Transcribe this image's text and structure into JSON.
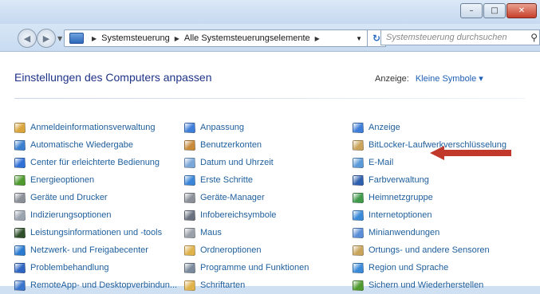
{
  "window": {
    "minimize": "–",
    "maximize": "□",
    "close": "✕"
  },
  "address": {
    "crumb1": "Systemsteuerung",
    "crumb2": "Alle Systemsteuerungselemente",
    "search_placeholder": "Systemsteuerung durchsuchen"
  },
  "header": {
    "title": "Einstellungen des Computers anpassen",
    "view_label": "Anzeige:",
    "view_value": "Kleine Symbole ▾"
  },
  "columns": [
    [
      {
        "label": "Anmeldeinformationsverwaltung",
        "icon": "credential-icon",
        "color": "#d9a53b"
      },
      {
        "label": "Automatische Wiedergabe",
        "icon": "autoplay-icon",
        "color": "#3a7fd0"
      },
      {
        "label": "Center für erleichterte Bedienung",
        "icon": "ease-of-access-icon",
        "color": "#2f6fd6"
      },
      {
        "label": "Energieoptionen",
        "icon": "power-icon",
        "color": "#4e9a2e"
      },
      {
        "label": "Geräte und Drucker",
        "icon": "printer-icon",
        "color": "#8a8f98"
      },
      {
        "label": "Indizierungsoptionen",
        "icon": "indexing-icon",
        "color": "#9aa3b0"
      },
      {
        "label": "Leistungsinformationen und -tools",
        "icon": "performance-icon",
        "color": "#2e4f2a"
      },
      {
        "label": "Netzwerk- und Freigabecenter",
        "icon": "network-icon",
        "color": "#2a7ad0"
      },
      {
        "label": "Problembehandlung",
        "icon": "troubleshoot-icon",
        "color": "#2e66c2"
      },
      {
        "label": "RemoteApp- und Desktopverbindun...",
        "icon": "remoteapp-icon",
        "color": "#3a74cc"
      }
    ],
    [
      {
        "label": "Anpassung",
        "icon": "personalize-icon",
        "color": "#3f7ed8"
      },
      {
        "label": "Benutzerkonten",
        "icon": "user-accounts-icon",
        "color": "#c78b3a"
      },
      {
        "label": "Datum und Uhrzeit",
        "icon": "clock-icon",
        "color": "#7aa6d8"
      },
      {
        "label": "Erste Schritte",
        "icon": "getting-started-icon",
        "color": "#3a85d8"
      },
      {
        "label": "Geräte-Manager",
        "icon": "device-manager-icon",
        "color": "#8a8f98"
      },
      {
        "label": "Infobereichsymbole",
        "icon": "tray-icon",
        "color": "#6a7280"
      },
      {
        "label": "Maus",
        "icon": "mouse-icon",
        "color": "#9aa0a8"
      },
      {
        "label": "Ordneroptionen",
        "icon": "folder-icon",
        "color": "#e0b24a"
      },
      {
        "label": "Programme und Funktionen",
        "icon": "programs-icon",
        "color": "#7a8a9c"
      },
      {
        "label": "Schriftarten",
        "icon": "fonts-icon",
        "color": "#e0b24a"
      }
    ],
    [
      {
        "label": "Anzeige",
        "icon": "display-icon",
        "color": "#3f7ed8"
      },
      {
        "label": "BitLocker-Laufwerkverschlüsselung",
        "icon": "bitlocker-icon",
        "color": "#c9a45a"
      },
      {
        "label": "E-Mail",
        "icon": "email-icon",
        "color": "#5a9ad8"
      },
      {
        "label": "Farbverwaltung",
        "icon": "color-mgmt-icon",
        "color": "#2e5fae"
      },
      {
        "label": "Heimnetzgruppe",
        "icon": "homegroup-icon",
        "color": "#3f9a4a"
      },
      {
        "label": "Internetoptionen",
        "icon": "internet-icon",
        "color": "#3a8ad8"
      },
      {
        "label": "Minianwendungen",
        "icon": "gadgets-icon",
        "color": "#5a8ed8"
      },
      {
        "label": "Ortungs- und andere Sensoren",
        "icon": "sensors-icon",
        "color": "#c9a45a"
      },
      {
        "label": "Region und Sprache",
        "icon": "region-icon",
        "color": "#3a8ad8"
      },
      {
        "label": "Sichern und Wiederherstellen",
        "icon": "backup-icon",
        "color": "#4e9a2e"
      }
    ]
  ],
  "annotation_color": "#c0392b"
}
